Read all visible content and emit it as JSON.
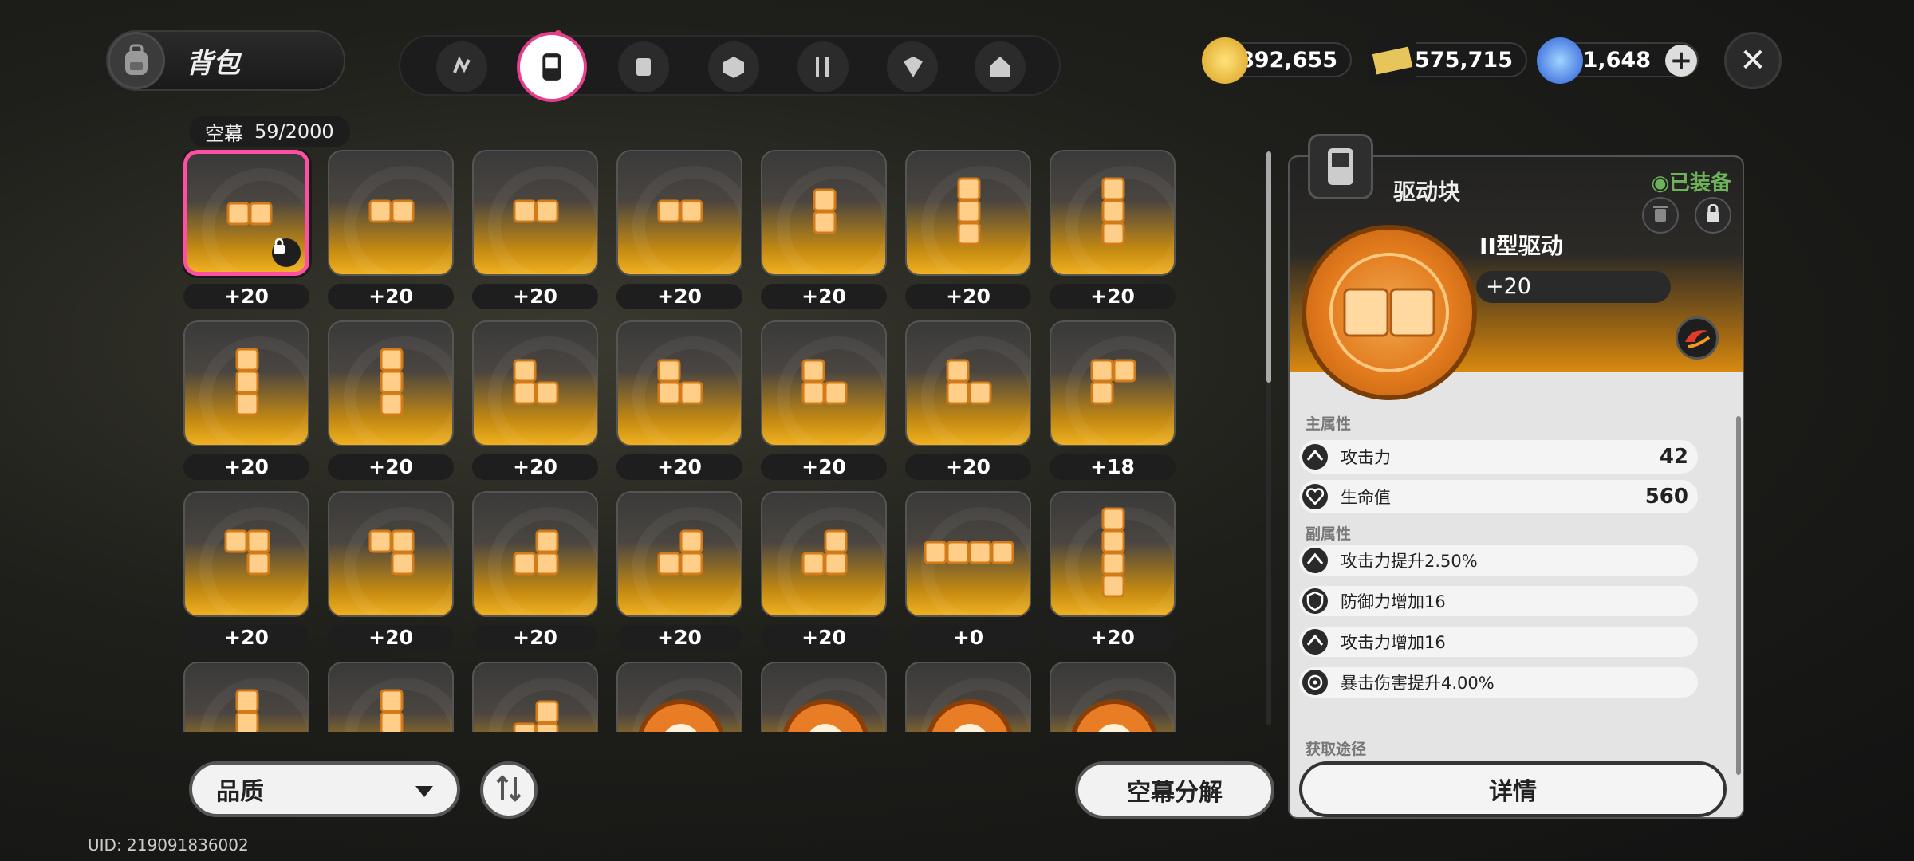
{
  "header": {
    "title": "背包",
    "categories": [
      {
        "name": "drive-disc-icon",
        "active": false
      },
      {
        "name": "bangboo-chip-icon",
        "active": true
      },
      {
        "name": "material-icon",
        "active": false
      },
      {
        "name": "box-icon",
        "active": false
      },
      {
        "name": "food-icon",
        "active": false
      },
      {
        "name": "tape-icon",
        "active": false
      },
      {
        "name": "home-icon",
        "active": false
      }
    ]
  },
  "currencies": [
    {
      "name": "gold-coin-icon",
      "value": "892,655"
    },
    {
      "name": "ticket-icon",
      "value": "575,715"
    },
    {
      "name": "crystal-icon",
      "value": "1,648"
    }
  ],
  "capacity": {
    "label": "空幕",
    "value": "59/2000"
  },
  "items": [
    {
      "shape": "h2",
      "level": "+20",
      "selected": true,
      "locked": true
    },
    {
      "shape": "h2",
      "level": "+20"
    },
    {
      "shape": "h2",
      "level": "+20"
    },
    {
      "shape": "h2",
      "level": "+20"
    },
    {
      "shape": "v2",
      "level": "+20"
    },
    {
      "shape": "v3",
      "level": "+20"
    },
    {
      "shape": "v3",
      "level": "+20"
    },
    {
      "shape": "v3",
      "level": "+20"
    },
    {
      "shape": "v3",
      "level": "+20"
    },
    {
      "shape": "L",
      "level": "+20"
    },
    {
      "shape": "L",
      "level": "+20"
    },
    {
      "shape": "L",
      "level": "+20"
    },
    {
      "shape": "L",
      "level": "+20"
    },
    {
      "shape": "P",
      "level": "+18"
    },
    {
      "shape": "Q",
      "level": "+20"
    },
    {
      "shape": "Q",
      "level": "+20"
    },
    {
      "shape": "J",
      "level": "+20"
    },
    {
      "shape": "J",
      "level": "+20"
    },
    {
      "shape": "J",
      "level": "+20"
    },
    {
      "shape": "h4",
      "level": "+0"
    },
    {
      "shape": "v4",
      "level": "+20"
    },
    {
      "shape": "v3",
      "level": ""
    },
    {
      "shape": "v3",
      "level": ""
    },
    {
      "shape": "J",
      "level": ""
    },
    {
      "shape": "disc",
      "level": ""
    },
    {
      "shape": "disc",
      "level": ""
    },
    {
      "shape": "disc",
      "level": ""
    },
    {
      "shape": "disc2",
      "level": ""
    }
  ],
  "bottom": {
    "quality_label": "品质",
    "dismantle_label": "空幕分解",
    "uid": "UID: 219091836002"
  },
  "detail": {
    "type_label": "驱动块",
    "equipped_label": "◉已装备",
    "item_name": "II型驱动",
    "item_level": "+20",
    "main_stats_label": "主属性",
    "main_stats": [
      {
        "icon": "attack-icon",
        "label": "攻击力",
        "value": "42"
      },
      {
        "icon": "hp-icon",
        "label": "生命值",
        "value": "560"
      }
    ],
    "sub_stats_label": "副属性",
    "sub_stats": [
      {
        "icon": "attack-icon",
        "label": "攻击力提升2.50%"
      },
      {
        "icon": "defense-icon",
        "label": "防御力增加16"
      },
      {
        "icon": "attack-icon",
        "label": "攻击力增加16"
      },
      {
        "icon": "crit-icon",
        "label": "暴击伤害提升4.00%"
      }
    ],
    "source_label": "获取途径",
    "details_button": "详情"
  },
  "colors": {
    "accent": "#e83d8c",
    "gold": "#f0b020",
    "equipped": "#6db35a"
  }
}
